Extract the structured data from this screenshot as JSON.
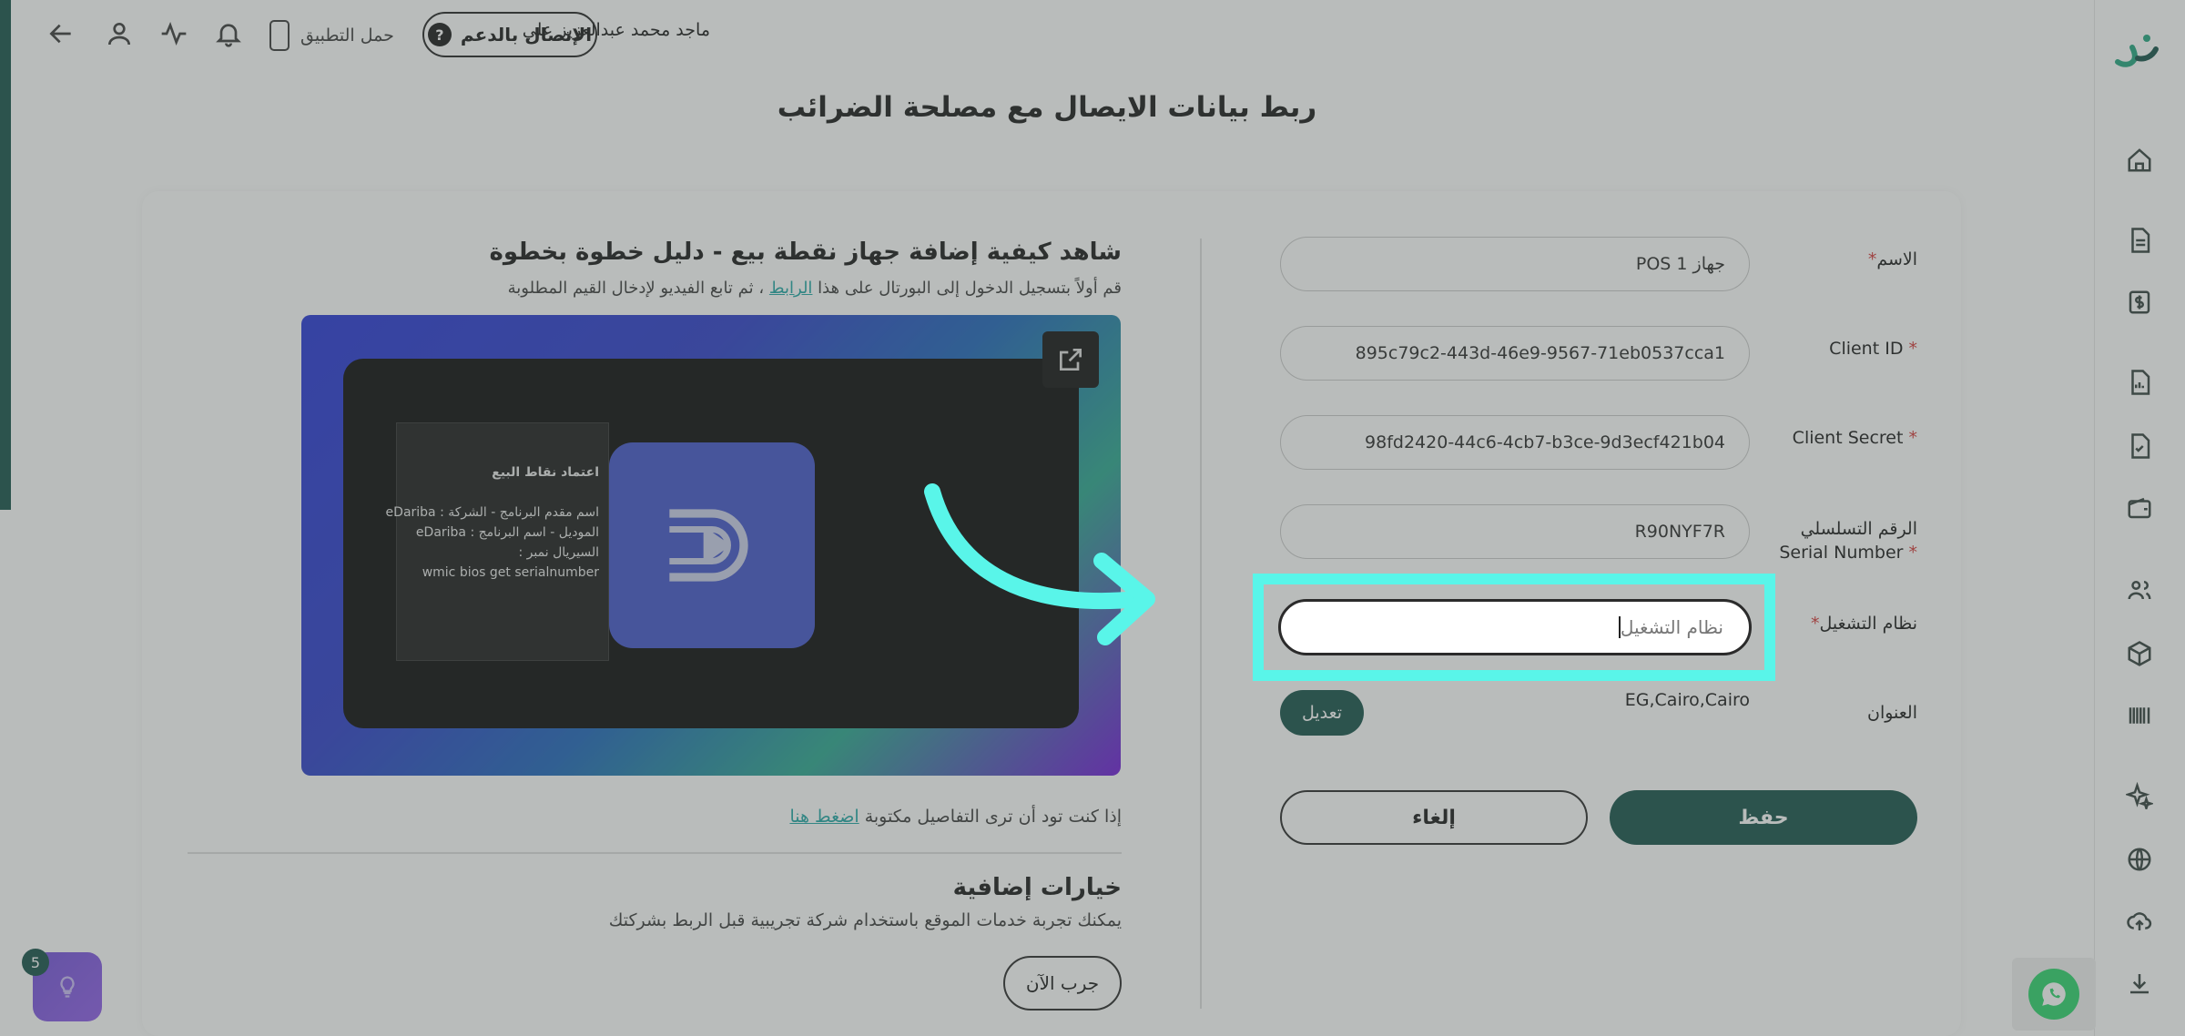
{
  "header": {
    "user_name": "ماجد محمد عبدالعزيز علي",
    "support_label": "الإتصال بالدعم",
    "support_icon": "?",
    "app_download": "حمل التطبيق"
  },
  "page": {
    "title": "ربط بيانات الايصال مع مصلحة الضرائب"
  },
  "form": {
    "name_label": "الاسم",
    "name_value": "جهاز POS 1",
    "client_id_label": "Client ID",
    "client_id_value": "895c79c2-443d-46e9-9567-71eb0537cca1",
    "client_secret_label": "Client Secret",
    "client_secret_value": "98fd2420-44c6-4cb7-b3ce-9d3ecf421b04",
    "serial_label_ar": "الرقم التسلسلي",
    "serial_label_en": "Serial Number",
    "serial_value": "R90NYF7R",
    "os_label": "نظام التشغيل",
    "os_placeholder": "نظام التشغيل",
    "address_label": "العنوان",
    "address_value": "EG,Cairo,Cairo",
    "edit_label": "تعديل",
    "save_label": "حفظ",
    "cancel_label": "إلغاء",
    "required_mark": "*"
  },
  "video": {
    "title": "شاهد كيفية إضافة جهاز نقطة بيع - دليل خطوة بخطوة",
    "subtitle_before": "قم أولاً بتسجيل الدخول إلى البورتال على هذا",
    "subtitle_link": "الرابط",
    "subtitle_after": "، ثم تابع الفيديو لإدخال القيم المطلوبة",
    "thumb_lines": [
      "اعتماد نقاط البيع",
      "اسم مقدم البرنامج - الشركة : eDariba",
      "الموديل - اسم البرنامج : eDariba",
      "السيريال نمبر :",
      "wmic bios get serialnumber"
    ]
  },
  "written": {
    "text": "إذا كنت تود أن ترى التفاصيل مكتوبة",
    "link": "اضغط هنا"
  },
  "extras": {
    "title": "خيارات إضافية",
    "subtitle": "يمكنك تجربة خدمات الموقع باستخدام شركة تجريبية قبل الربط بشركتك",
    "try_label": "جرب الآن"
  },
  "help": {
    "count": "5"
  },
  "colors": {
    "brand": "#0d4a42",
    "highlight": "#59f5e9",
    "link": "#17a2a0",
    "required": "#d32f2f"
  }
}
